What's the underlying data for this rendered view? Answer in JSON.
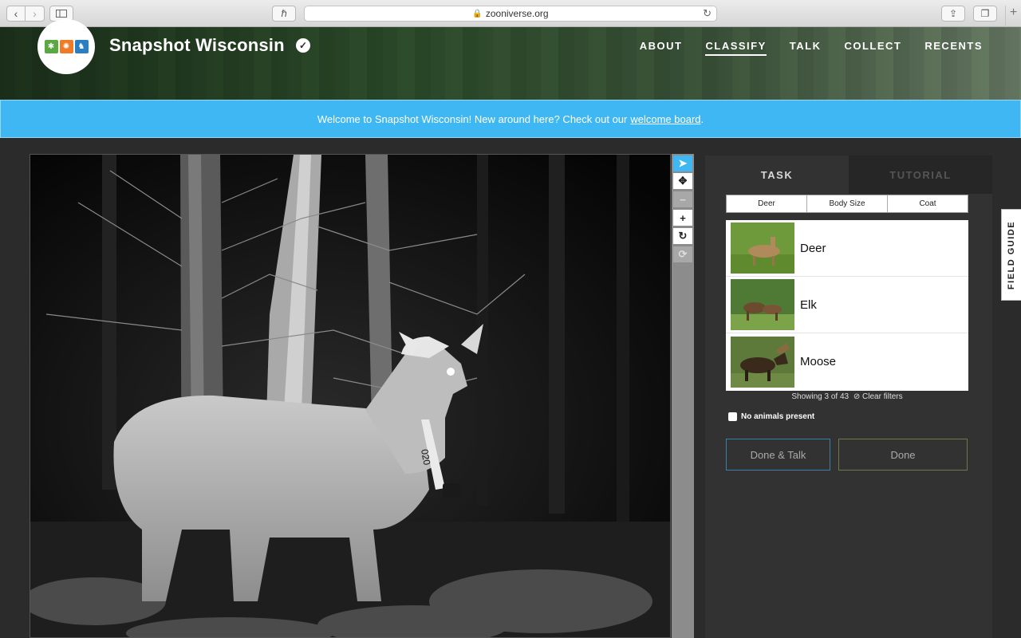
{
  "browser": {
    "url": "zooniverse.org",
    "back_icon": "chevron-left-icon",
    "forward_icon": "chevron-right-icon"
  },
  "header": {
    "title": "Snapshot Wisconsin",
    "nav": [
      {
        "label": "ABOUT"
      },
      {
        "label": "CLASSIFY",
        "active": true
      },
      {
        "label": "TALK"
      },
      {
        "label": "COLLECT"
      },
      {
        "label": "RECENTS"
      }
    ]
  },
  "banner": {
    "text": "Welcome to Snapshot Wisconsin! New around here? Check out our",
    "link": "welcome board",
    "suffix": "."
  },
  "image": {
    "collar_text": "020"
  },
  "tools": [
    "pointer-icon",
    "pan-icon",
    "zoom-out-icon",
    "zoom-in-icon",
    "rotate-icon",
    "reset-icon"
  ],
  "panel": {
    "tabs": [
      {
        "label": "TASK",
        "active": true
      },
      {
        "label": "TUTORIAL"
      }
    ],
    "filters": [
      {
        "label": "Deer"
      },
      {
        "label": "Body Size"
      },
      {
        "label": "Coat"
      }
    ],
    "choices": [
      {
        "label": "Deer"
      },
      {
        "label": "Elk"
      },
      {
        "label": "Moose"
      }
    ],
    "showing": "Showing 3 of 43",
    "clear_filters": "Clear filters",
    "no_animals": "No animals present",
    "done_talk": "Done & Talk",
    "done": "Done"
  },
  "field_guide": {
    "label": "FIELD GUIDE"
  },
  "colors": {
    "accent": "#3fb7f2",
    "panel_bg": "#323232",
    "done_talk_border": "#3a7fa8",
    "done_border": "#6b7a46"
  }
}
